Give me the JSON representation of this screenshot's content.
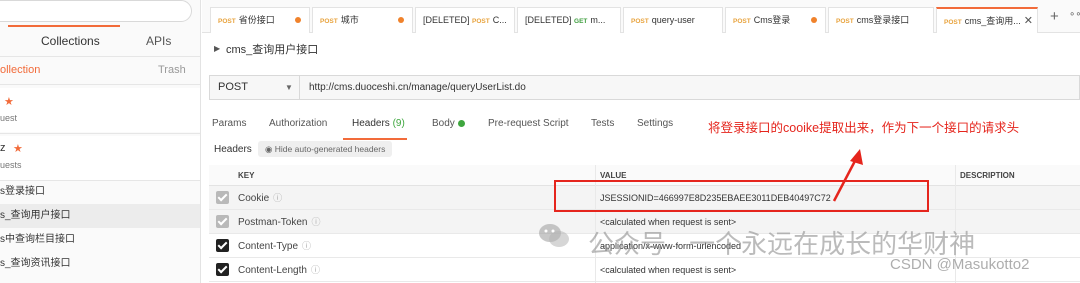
{
  "sidebar": {
    "tabs": [
      {
        "label": "Collections"
      },
      {
        "label": "APIs"
      }
    ],
    "new_collection": "ollection",
    "trash": "Trash",
    "collections": [
      {
        "name": "",
        "requests": "uest"
      },
      {
        "name": "z",
        "requests": "uests"
      }
    ],
    "items": [
      {
        "label": "s登录接口"
      },
      {
        "label": "s_查询用户接口"
      },
      {
        "label": "s中查询栏目接口"
      },
      {
        "label": "s_查询资讯接口"
      }
    ]
  },
  "tabs": [
    {
      "method": "POST",
      "title": "省份接口",
      "unsaved": true
    },
    {
      "method": "POST",
      "title": "城市",
      "unsaved": true
    },
    {
      "prefix": "[DELETED]",
      "method": "POST",
      "title": "C..."
    },
    {
      "prefix": "[DELETED]",
      "method": "GET",
      "title": "m..."
    },
    {
      "method": "POST",
      "title": "query-user"
    },
    {
      "method": "POST",
      "title": "Cms登录",
      "unsaved": true
    },
    {
      "method": "POST",
      "title": "cms登录接口"
    },
    {
      "method": "POST",
      "title": "cms_查询用...",
      "active": true
    }
  ],
  "request": {
    "title": "cms_查询用户接口",
    "method": "POST",
    "url": "http://cms.duoceshi.cn/manage/queryUserList.do"
  },
  "req_tabs": [
    {
      "label": "Params"
    },
    {
      "label": "Authorization"
    },
    {
      "label": "Headers",
      "count": "(9)",
      "active": true
    },
    {
      "label": "Body"
    },
    {
      "label": "Pre-request Script"
    },
    {
      "label": "Tests"
    },
    {
      "label": "Settings"
    }
  ],
  "annotation": "将登录接口的cooike提取出来，作为下一个接口的请求头",
  "headers_section": {
    "label": "Headers",
    "hide_auto": "Hide auto-generated headers"
  },
  "table": {
    "columns": [
      "KEY",
      "VALUE",
      "DESCRIPTION"
    ],
    "rows": [
      {
        "key": "Cookie",
        "value": "JSESSIONID=466997E8D235EBAEE3011DEB40497C72",
        "auto": true
      },
      {
        "key": "Postman-Token",
        "value": "<calculated when request is sent>",
        "auto": true
      },
      {
        "key": "Content-Type",
        "value": "application/x-www-form-urlencoded",
        "auto": false
      },
      {
        "key": "Content-Length",
        "value": "<calculated when request is sent>",
        "auto": false
      }
    ]
  },
  "watermark": {
    "text": "公众号 · 一个永远在成长的华财神",
    "csdn": "CSDN @Masukotto2"
  },
  "colors": {
    "accent": "#f26b3a",
    "annotation": "#e5251d",
    "count_green": "#3ea63e"
  }
}
